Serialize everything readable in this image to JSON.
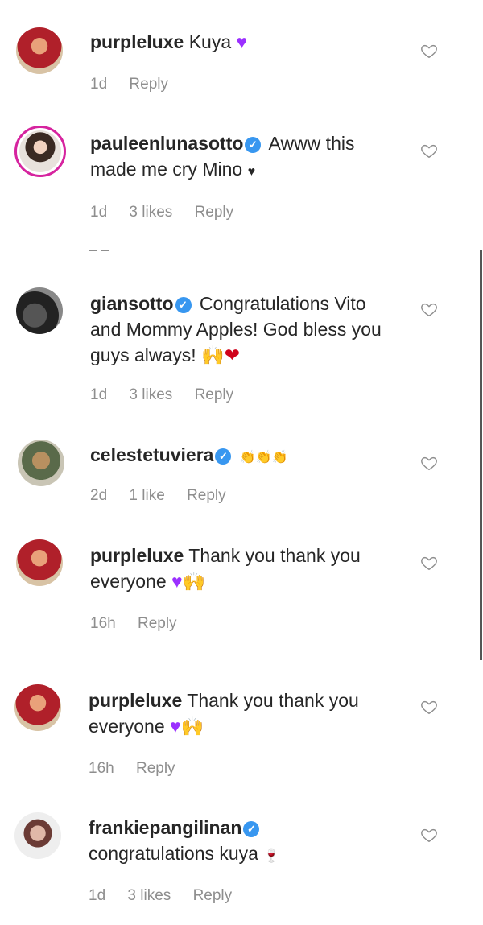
{
  "comments": [
    {
      "username": "purpleluxe",
      "verified": false,
      "text": "Kuya",
      "emoji": "♥",
      "time": "1d",
      "likes": "",
      "reply": "Reply"
    },
    {
      "username": "pauleenlunasotto",
      "verified": true,
      "text": "Awww this made me cry Mino",
      "emoji": "♥",
      "time": "1d",
      "likes": "3 likes",
      "reply": "Reply"
    },
    {
      "username": "giansotto",
      "verified": true,
      "text": "Congratulations Vito and Mommy Apples! God bless you guys always!",
      "emoji": "🙌❤",
      "time": "1d",
      "likes": "3 likes",
      "reply": "Reply"
    },
    {
      "username": "celestetuviera",
      "verified": true,
      "text": "👏👏👏",
      "emoji": "",
      "time": "2d",
      "likes": "1 like",
      "reply": "Reply"
    },
    {
      "username": "purpleluxe",
      "verified": false,
      "text": "Thank you thank you everyone",
      "emoji": "♥🙌",
      "time": "16h",
      "likes": "",
      "reply": "Reply"
    },
    {
      "username": "purpleluxe",
      "verified": false,
      "text": "Thank you thank you everyone",
      "emoji": "♥🙌",
      "time": "16h",
      "likes": "",
      "reply": "Reply"
    },
    {
      "username": "frankiepangilinan",
      "verified": true,
      "text": "congratulations kuya",
      "emoji": "🍷",
      "time": "1d",
      "likes": "3 likes",
      "reply": "Reply"
    }
  ],
  "hidden_replies": "– –",
  "colors": {
    "verified": "#3897f0",
    "meta": "#8e8e8e",
    "text": "#262626"
  }
}
